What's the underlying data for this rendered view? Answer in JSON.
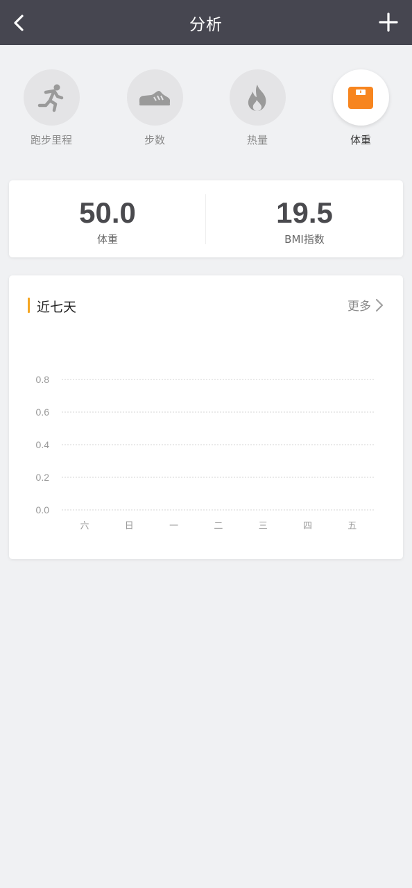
{
  "header": {
    "title": "分析",
    "back_icon": "chevron-left-icon",
    "add_icon": "plus-icon",
    "background": "#464650"
  },
  "tabs": [
    {
      "label": "跑步里程",
      "icon": "running-icon",
      "active": false
    },
    {
      "label": "步数",
      "icon": "sneaker-icon",
      "active": false
    },
    {
      "label": "热量",
      "icon": "flame-icon",
      "active": false
    },
    {
      "label": "体重",
      "icon": "scale-icon",
      "active": true
    }
  ],
  "stats": {
    "weight_value": "50.0",
    "weight_label": "体重",
    "bmi_value": "19.5",
    "bmi_label": "BMI指数"
  },
  "chart_card": {
    "title": "近七天",
    "more_label": "更多",
    "accent": "#f5a623"
  },
  "chart_data": {
    "type": "line",
    "categories": [
      "六",
      "日",
      "一",
      "二",
      "三",
      "四",
      "五"
    ],
    "series": [],
    "yticks": [
      "0.0",
      "0.2",
      "0.4",
      "0.6",
      "0.8"
    ],
    "ylim": [
      0,
      0.8
    ],
    "grid": true
  },
  "colors": {
    "scale_icon": "#f7851f",
    "inactive_icon": "#9a9a9a"
  }
}
